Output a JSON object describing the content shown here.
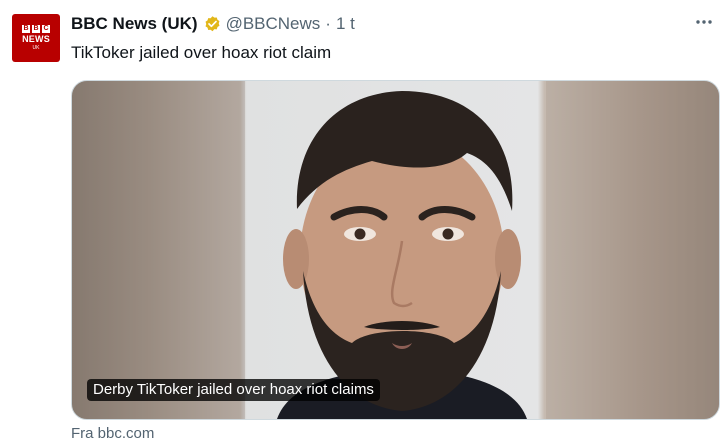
{
  "tweet": {
    "author_name": "BBC News (UK)",
    "author_handle": "@BBCNews",
    "separator": "·",
    "time": "1 t",
    "text": "TikToker jailed over hoax riot claim",
    "avatar": {
      "blocks": [
        "B",
        "B",
        "C"
      ],
      "line1": "NEWS",
      "line2": "UK",
      "color": "#b80000"
    },
    "verified_icon": "gold-check-badge-icon",
    "more_icon": "more-dots-icon"
  },
  "card": {
    "caption": "Derby TikToker jailed over hoax riot claims",
    "source": "Fra bbc.com"
  },
  "colors": {
    "text": "#0f1419",
    "secondary": "#536471",
    "border": "#cfd9de",
    "verified": "#e2b719"
  }
}
